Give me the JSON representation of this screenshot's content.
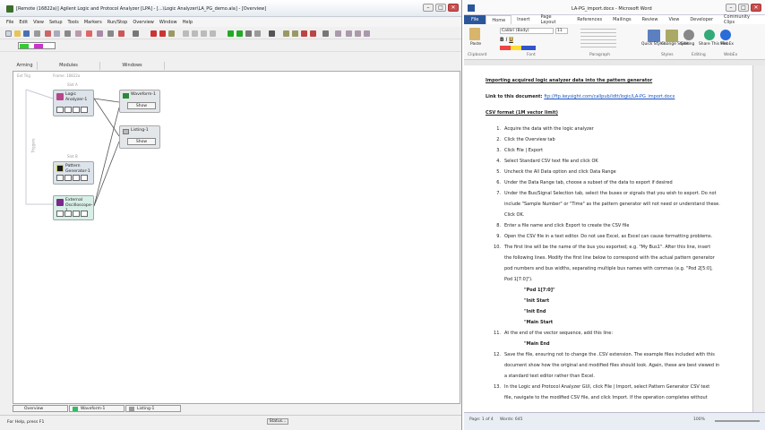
{
  "left_app": {
    "title": "[Remote (16822a)] Agilent Logic and Protocol Analyzer [LPA] - [...\\Logic Analyzer\\LA_PG_demo.ala] - [Overview]",
    "menu": [
      "File",
      "Edit",
      "View",
      "Setup",
      "Tools",
      "Markers",
      "Run/Stop",
      "Overview",
      "Window",
      "Help"
    ],
    "panel_headers": {
      "arming": "Arming",
      "modules": "Modules",
      "windows": "Windows"
    },
    "canvas_labels": {
      "ext_trig": "Ext Trig",
      "frame": "Frame: 16822a",
      "slot_a": "Slot A",
      "slot_b": "Slot B",
      "triggers": "Triggers"
    },
    "modules": [
      {
        "name": "Logic Analyzer-1"
      },
      {
        "name": "Pattern Generator-1"
      },
      {
        "name": "External Oscilloscope-1"
      }
    ],
    "windows": [
      {
        "name": "Waveform-1",
        "show": "Show"
      },
      {
        "name": "Listing-1",
        "show": "Show"
      }
    ],
    "tabs": [
      "Overview",
      "Waveform-1",
      "Listing-1"
    ],
    "status_help": "For Help, press F1",
    "status_button": "Status..."
  },
  "right_app": {
    "title": "LA-PG_import.docx - Microsoft Word",
    "tabs": [
      "File",
      "Home",
      "Insert",
      "Page Layout",
      "References",
      "Mailings",
      "Review",
      "View",
      "Developer",
      "Community Clips"
    ],
    "ribbon": {
      "paste": "Paste",
      "font_name": "Calibri (Body)",
      "font_size": "11",
      "groups": [
        "Clipboard",
        "Font",
        "Paragraph",
        "Styles",
        "Editing",
        "WebEx"
      ],
      "buttons": [
        "Quick Styles",
        "Change Styles",
        "Editing",
        "Share This File",
        "WebEx"
      ]
    },
    "doc": {
      "heading": "Importing acquired logic analyzer data into the pattern generator",
      "link_label": "Link to this document:",
      "link_url": "ftp://ftp.keysight.com/callpub/ldtt/logic/LA-PG_import.docx",
      "section": "CSV format (1M vector limit)",
      "steps": [
        {
          "n": "1.",
          "text": "Acquire the data with the logic analyzer"
        },
        {
          "n": "2.",
          "text": "Click the Overview tab"
        },
        {
          "n": "3.",
          "text": "Click File | Export"
        },
        {
          "n": "4.",
          "text": "Select Standard CSV text file and click OK"
        },
        {
          "n": "5.",
          "text": "Uncheck the All Data option and click Data Range"
        },
        {
          "n": "6.",
          "text": "Under the Data Range tab, choose a subset of the data to export if desired"
        },
        {
          "n": "7.",
          "text": "Under the Bus/Signal Selection tab, select the buses or signals that you wish to export.  Do not"
        },
        {
          "n": "",
          "text": "include \"Sample Number\" or \"Time\" as the pattern generator will not need or understand these."
        },
        {
          "n": "",
          "text": "Click OK."
        },
        {
          "n": "8.",
          "text": "Enter a file name and click Export to create the CSV file"
        },
        {
          "n": "9.",
          "text": "Open the CSV file in a text editor.  Do not use Excel, as Excel can cause formatting problems."
        },
        {
          "n": "10.",
          "text": "The first line will be the name of the bus you exported; e.g. \"My Bus1\".  After this line, insert"
        },
        {
          "n": "",
          "text": "the following lines.  Modify the first line below to correspond with the actual pattern generator"
        },
        {
          "n": "",
          "text": "pod numbers and bus widths, separating multiple bus names with commas (e.g. \"Pod 2[5:0],"
        },
        {
          "n": "",
          "text": "Pod 1[7:0]\")."
        },
        {
          "n": "",
          "text": "\"Pod 1[7:0]\"",
          "code": true
        },
        {
          "n": "",
          "text": "\"Init Start",
          "code": true
        },
        {
          "n": "",
          "text": "\"Init End",
          "code": true
        },
        {
          "n": "",
          "text": "\"Main Start",
          "code": true
        },
        {
          "n": "11.",
          "text": "At the end of the vector sequence, add this line:"
        },
        {
          "n": "",
          "text": "\"Main End",
          "code": true
        },
        {
          "n": "12.",
          "text": "Save the file, ensuring not to change the .CSV extension.  The example files included with this"
        },
        {
          "n": "",
          "text": "document show how the original and modified files should look.  Again, these are best viewed in"
        },
        {
          "n": "",
          "text": "a standard text editor rather than Excel."
        },
        {
          "n": "13.",
          "text": "In the Logic and Protocol Analyzer GUI, click File | Import, select Pattern Generator CSV text"
        },
        {
          "n": "",
          "text": "file, navigate to the modified CSV file, and click Import.  If the operation completes without"
        }
      ]
    },
    "status": {
      "page": "Page: 1 of 4",
      "words": "Words: 645",
      "zoom": "100%"
    }
  }
}
